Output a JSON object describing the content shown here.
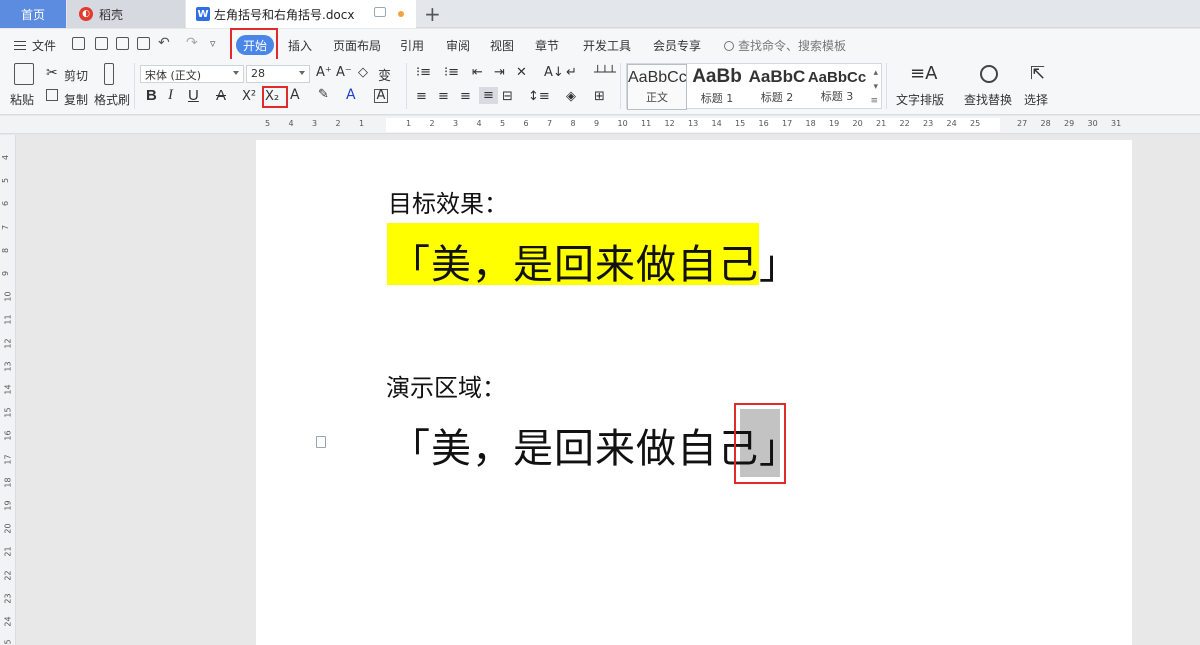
{
  "tabs": {
    "home": "首页",
    "daoke": "稻壳",
    "doc": "左角括号和右角括号.docx",
    "plus": "+"
  },
  "menu": {
    "file": "文件",
    "items": [
      "开始",
      "插入",
      "页面布局",
      "引用",
      "审阅",
      "视图",
      "章节",
      "开发工具",
      "会员专享"
    ],
    "search_hint": "查找命令、搜索模板"
  },
  "ribbon": {
    "paste": "粘贴",
    "cut": "剪切",
    "copy": "复制",
    "format_painter": "格式刷",
    "font_name": "宋体 (正文)",
    "font_size": "28",
    "bold": "B",
    "italic": "I",
    "underline": "U",
    "strikethrough": "A",
    "superscript": "X²",
    "subscript": "X₂",
    "styles": [
      {
        "sample": "AaBbCcDd",
        "label": "正文"
      },
      {
        "sample": "AaBb",
        "label": "标题 1"
      },
      {
        "sample": "AaBbC",
        "label": "标题 2"
      },
      {
        "sample": "AaBbCc",
        "label": "标题 3"
      }
    ],
    "text_layout": "文字排版",
    "find_replace": "查找替换",
    "select": "选择"
  },
  "ruler": {
    "h_ticks": [
      "5",
      "4",
      "3",
      "2",
      "1",
      "",
      "1",
      "2",
      "3",
      "4",
      "5",
      "6",
      "7",
      "8",
      "9",
      "10",
      "11",
      "12",
      "13",
      "14",
      "15",
      "16",
      "17",
      "18",
      "19",
      "20",
      "21",
      "22",
      "23",
      "24",
      "25",
      "",
      "27",
      "28",
      "29",
      "30",
      "31"
    ],
    "v_ticks": [
      "4",
      "5",
      "6",
      "7",
      "8",
      "9",
      "10",
      "11",
      "12",
      "13",
      "14",
      "15",
      "16",
      "17",
      "18",
      "19",
      "20",
      "21",
      "22",
      "23",
      "24",
      "25"
    ]
  },
  "document": {
    "heading1": "目标效果：",
    "line1": "「美，是回来做自己」",
    "heading2": "演示区域：",
    "line2": "「美，是回来做自己",
    "line2_selected": "」"
  },
  "colors": {
    "accent": "#4a86e8",
    "highlight": "#ffff00",
    "annotation": "#e02b2b",
    "selection": "#c3c3c3"
  }
}
